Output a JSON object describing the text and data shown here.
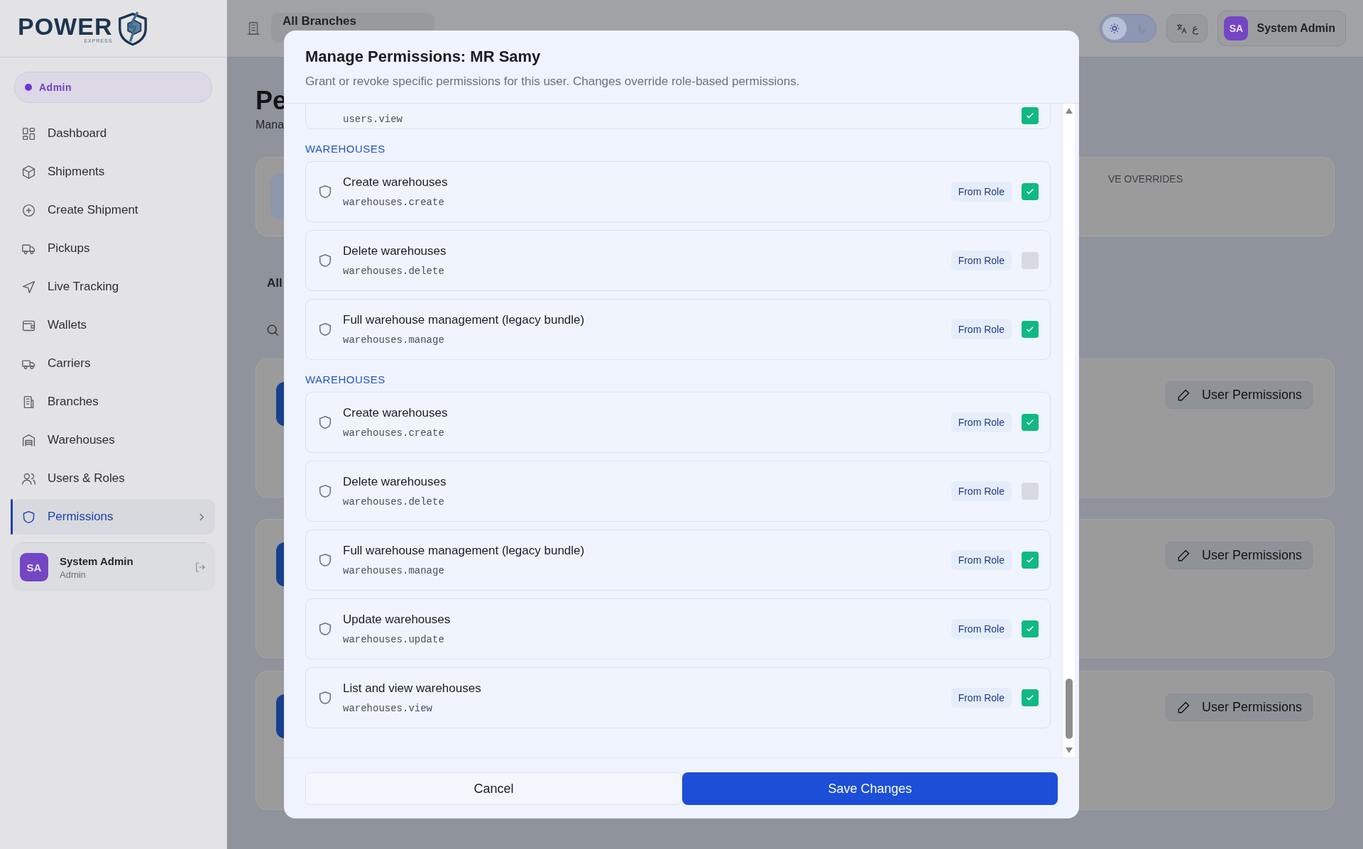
{
  "logo": {
    "name": "POWER",
    "tagline": "EXPRESS"
  },
  "role_badge": "Admin",
  "sidebar": {
    "items": [
      {
        "label": "Dashboard",
        "selected": false
      },
      {
        "label": "Shipments",
        "selected": false
      },
      {
        "label": "Create Shipment",
        "selected": false
      },
      {
        "label": "Pickups",
        "selected": false
      },
      {
        "label": "Live Tracking",
        "selected": false
      },
      {
        "label": "Wallets",
        "selected": false
      },
      {
        "label": "Carriers",
        "selected": false
      },
      {
        "label": "Branches",
        "selected": false
      },
      {
        "label": "Warehouses",
        "selected": false
      },
      {
        "label": "Users & Roles",
        "selected": false
      },
      {
        "label": "Permissions",
        "selected": true
      }
    ]
  },
  "sidebar_user": {
    "initials": "SA",
    "name": "System Admin",
    "role": "Admin"
  },
  "header": {
    "branch_select": "All Branches",
    "theme_options": [
      {
        "selected": true
      },
      {
        "selected": false
      }
    ],
    "language": "ع",
    "user": {
      "initials": "SA",
      "name": "System Admin"
    }
  },
  "page": {
    "title": "Pe",
    "subtitle": "Mana",
    "stats_label": "VE OVERRIDES",
    "filter_tab": "All",
    "cards": [
      {
        "button": "User Permissions"
      },
      {
        "button": "User Permissions"
      },
      {
        "button": "User Permissions"
      }
    ]
  },
  "modal": {
    "title": "Manage Permissions: MR Samy",
    "description": "Grant or revoke specific permissions for this user. Changes override role-based permissions.",
    "partial_row": {
      "code": "users.view",
      "checked": true
    },
    "groups": [
      {
        "heading": "WAREHOUSES",
        "permissions": [
          {
            "name": "Create warehouses",
            "code": "warehouses.create",
            "source": "From Role",
            "checked": true
          },
          {
            "name": "Delete warehouses",
            "code": "warehouses.delete",
            "source": "From Role",
            "checked": false
          },
          {
            "name": "Full warehouse management (legacy bundle)",
            "code": "warehouses.manage",
            "source": "From Role",
            "checked": true
          }
        ]
      },
      {
        "heading": "WAREHOUSES",
        "permissions": [
          {
            "name": "Create warehouses",
            "code": "warehouses.create",
            "source": "From Role",
            "checked": true
          },
          {
            "name": "Delete warehouses",
            "code": "warehouses.delete",
            "source": "From Role",
            "checked": false
          },
          {
            "name": "Full warehouse management (legacy bundle)",
            "code": "warehouses.manage",
            "source": "From Role",
            "checked": true
          },
          {
            "name": "Update warehouses",
            "code": "warehouses.update",
            "source": "From Role",
            "checked": true
          },
          {
            "name": "List and view warehouses",
            "code": "warehouses.view",
            "source": "From Role",
            "checked": true
          }
        ]
      }
    ],
    "cancel": "Cancel",
    "save": "Save Changes"
  }
}
